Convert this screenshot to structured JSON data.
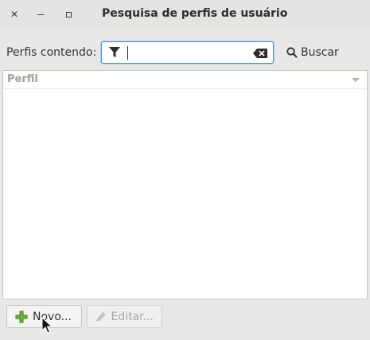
{
  "window": {
    "title": "Pesquisa de perfis de usuário"
  },
  "search": {
    "label": "Perfis contendo:",
    "value": "",
    "button_label": "Buscar"
  },
  "list": {
    "columns": [
      "Perfil"
    ],
    "rows": []
  },
  "actions": {
    "new_label": "Novo...",
    "edit_label": "Editar..."
  },
  "colors": {
    "focus_border": "#4a90d9",
    "plus_green": "#5aa02c"
  }
}
